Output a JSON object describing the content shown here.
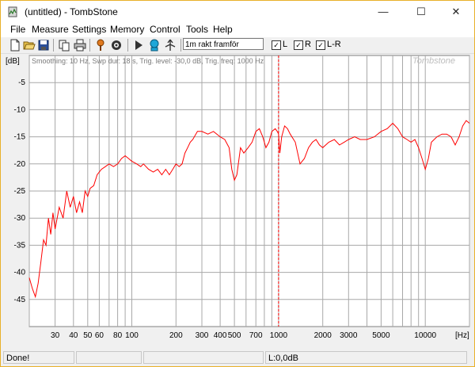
{
  "window": {
    "title": "(untitled) - TombStone",
    "minimize_glyph": "—",
    "maximize_glyph": "☐",
    "close_glyph": "✕"
  },
  "menu": [
    "File",
    "Measure",
    "Settings",
    "Memory",
    "Control",
    "Tools",
    "Help"
  ],
  "toolbar": {
    "icons": [
      "new-icon",
      "open-icon",
      "save-icon",
      "copy-icon",
      "print-icon",
      "signal-generator-icon",
      "settings-icon",
      "play-icon",
      "microphone-icon",
      "calibrate-icon"
    ],
    "description": "1m rakt framför",
    "checkboxes": [
      {
        "label": "L",
        "checked": true
      },
      {
        "label": "R",
        "checked": true
      },
      {
        "label": "L-R",
        "checked": true
      }
    ],
    "check_glyph": "✓"
  },
  "chart_data": {
    "type": "line",
    "info_text": "Smoothing: 10 Hz, Swp dur: 18 s, Trig. level: -30,0 dB, Trig. freq: 1000 Hz",
    "watermark": "Tombstone",
    "ylabel": "[dB]",
    "xlabel": "[Hz]",
    "x_scale": "log",
    "xlim": [
      20,
      20000
    ],
    "ylim": [
      -50,
      0
    ],
    "y_ticks": [
      -5,
      -10,
      -15,
      -20,
      -25,
      -30,
      -35,
      -40,
      -45
    ],
    "x_ticks": [
      {
        "value": 30,
        "label": "30"
      },
      {
        "value": 40,
        "label": "40"
      },
      {
        "value": 50,
        "label": "50"
      },
      {
        "value": 60,
        "label": "60"
      },
      {
        "value": 80,
        "label": "80"
      },
      {
        "value": 100,
        "label": "100"
      },
      {
        "value": 200,
        "label": "200"
      },
      {
        "value": 300,
        "label": "300"
      },
      {
        "value": 400,
        "label": "400"
      },
      {
        "value": 500,
        "label": "500"
      },
      {
        "value": 700,
        "label": "700"
      },
      {
        "value": 1000,
        "label": "1000"
      },
      {
        "value": 2000,
        "label": "2000"
      },
      {
        "value": 3000,
        "label": "3000"
      },
      {
        "value": 5000,
        "label": "5000"
      },
      {
        "value": 10000,
        "label": "10000"
      }
    ],
    "minor_x": [
      20,
      30,
      40,
      50,
      60,
      70,
      80,
      90,
      100,
      200,
      300,
      400,
      500,
      600,
      700,
      800,
      900,
      1000,
      2000,
      3000,
      4000,
      5000,
      6000,
      7000,
      8000,
      9000,
      10000,
      20000
    ],
    "cursor_freq": 1000,
    "grid": true,
    "series": [
      {
        "color": "#ff0000",
        "x": [
          20,
          21,
          22,
          23,
          24,
          25,
          26,
          27,
          28,
          29,
          30,
          32,
          34,
          36,
          38,
          40,
          42,
          44,
          46,
          48,
          50,
          52,
          55,
          58,
          62,
          66,
          70,
          75,
          80,
          85,
          90,
          95,
          100,
          108,
          115,
          120,
          130,
          140,
          150,
          160,
          170,
          180,
          190,
          200,
          210,
          220,
          230,
          240,
          250,
          260,
          280,
          300,
          330,
          360,
          400,
          430,
          460,
          480,
          500,
          520,
          550,
          580,
          620,
          660,
          700,
          740,
          780,
          820,
          860,
          900,
          950,
          980,
          1000,
          1020,
          1050,
          1100,
          1150,
          1200,
          1300,
          1400,
          1500,
          1600,
          1700,
          1800,
          1900,
          2000,
          2200,
          2400,
          2600,
          2800,
          3000,
          3300,
          3600,
          4000,
          4500,
          5000,
          5500,
          6000,
          6500,
          7000,
          7500,
          8000,
          8500,
          9000,
          9500,
          10000,
          10500,
          11000,
          12000,
          13000,
          14000,
          15000,
          16000,
          17000,
          18000,
          19000,
          20000
        ],
        "y": [
          -41,
          -43,
          -44.5,
          -42,
          -38,
          -34,
          -35,
          -30,
          -33,
          -29,
          -32,
          -28,
          -30,
          -25,
          -28,
          -26,
          -29,
          -27,
          -29,
          -25,
          -26,
          -24.5,
          -24,
          -22,
          -21,
          -20.5,
          -20,
          -20.5,
          -20,
          -19,
          -18.5,
          -19,
          -19.5,
          -20,
          -20.5,
          -20,
          -21,
          -21.5,
          -21,
          -22,
          -21,
          -22,
          -21,
          -20,
          -20.5,
          -20,
          -18,
          -17,
          -16,
          -15.5,
          -14,
          -14,
          -14.5,
          -14,
          -15,
          -15.5,
          -17,
          -21,
          -23,
          -22,
          -17,
          -18,
          -17,
          -16,
          -14,
          -13.5,
          -15,
          -17,
          -16,
          -14,
          -13.5,
          -14,
          -14.5,
          -18,
          -15,
          -13,
          -13.5,
          -14.5,
          -16,
          -20,
          -19,
          -17,
          -16,
          -15.5,
          -16.5,
          -17,
          -16,
          -15.5,
          -16.5,
          -16,
          -15.5,
          -15,
          -15.5,
          -15.5,
          -15,
          -14,
          -13.5,
          -12.5,
          -13.5,
          -15,
          -15.5,
          -16,
          -15.5,
          -17,
          -19,
          -21,
          -19,
          -16,
          -15,
          -14.5,
          -14.5,
          -15,
          -16.5,
          -15,
          -13,
          -12,
          -12.5
        ]
      }
    ]
  },
  "status": {
    "message": "Done!",
    "level": "L:0,0dB"
  }
}
